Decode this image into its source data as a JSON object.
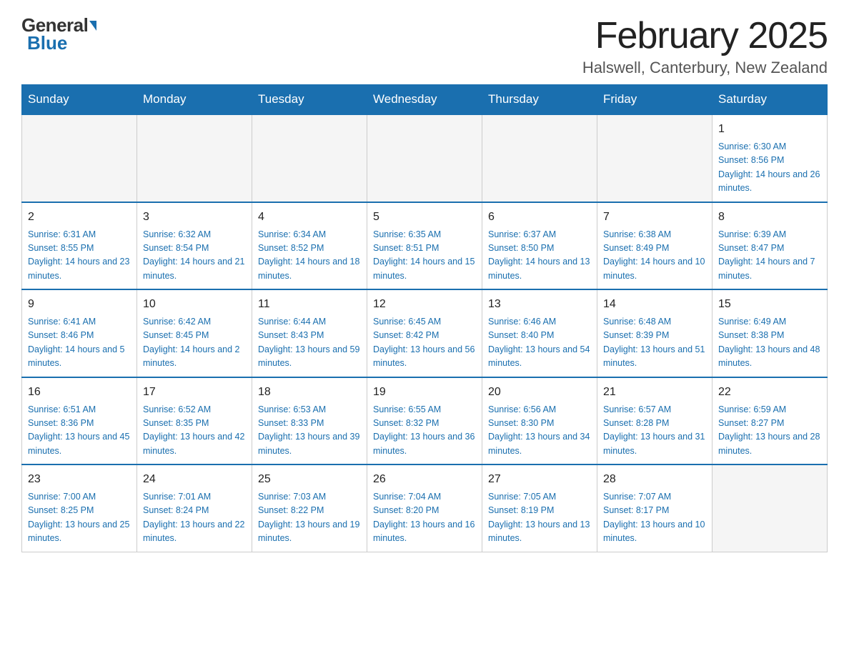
{
  "logo": {
    "general": "General",
    "blue": "Blue"
  },
  "title": "February 2025",
  "subtitle": "Halswell, Canterbury, New Zealand",
  "days_of_week": [
    "Sunday",
    "Monday",
    "Tuesday",
    "Wednesday",
    "Thursday",
    "Friday",
    "Saturday"
  ],
  "weeks": [
    [
      {
        "day": "",
        "empty": true
      },
      {
        "day": "",
        "empty": true
      },
      {
        "day": "",
        "empty": true
      },
      {
        "day": "",
        "empty": true
      },
      {
        "day": "",
        "empty": true
      },
      {
        "day": "",
        "empty": true
      },
      {
        "day": "1",
        "sunrise": "Sunrise: 6:30 AM",
        "sunset": "Sunset: 8:56 PM",
        "daylight": "Daylight: 14 hours and 26 minutes."
      }
    ],
    [
      {
        "day": "2",
        "sunrise": "Sunrise: 6:31 AM",
        "sunset": "Sunset: 8:55 PM",
        "daylight": "Daylight: 14 hours and 23 minutes."
      },
      {
        "day": "3",
        "sunrise": "Sunrise: 6:32 AM",
        "sunset": "Sunset: 8:54 PM",
        "daylight": "Daylight: 14 hours and 21 minutes."
      },
      {
        "day": "4",
        "sunrise": "Sunrise: 6:34 AM",
        "sunset": "Sunset: 8:52 PM",
        "daylight": "Daylight: 14 hours and 18 minutes."
      },
      {
        "day": "5",
        "sunrise": "Sunrise: 6:35 AM",
        "sunset": "Sunset: 8:51 PM",
        "daylight": "Daylight: 14 hours and 15 minutes."
      },
      {
        "day": "6",
        "sunrise": "Sunrise: 6:37 AM",
        "sunset": "Sunset: 8:50 PM",
        "daylight": "Daylight: 14 hours and 13 minutes."
      },
      {
        "day": "7",
        "sunrise": "Sunrise: 6:38 AM",
        "sunset": "Sunset: 8:49 PM",
        "daylight": "Daylight: 14 hours and 10 minutes."
      },
      {
        "day": "8",
        "sunrise": "Sunrise: 6:39 AM",
        "sunset": "Sunset: 8:47 PM",
        "daylight": "Daylight: 14 hours and 7 minutes."
      }
    ],
    [
      {
        "day": "9",
        "sunrise": "Sunrise: 6:41 AM",
        "sunset": "Sunset: 8:46 PM",
        "daylight": "Daylight: 14 hours and 5 minutes."
      },
      {
        "day": "10",
        "sunrise": "Sunrise: 6:42 AM",
        "sunset": "Sunset: 8:45 PM",
        "daylight": "Daylight: 14 hours and 2 minutes."
      },
      {
        "day": "11",
        "sunrise": "Sunrise: 6:44 AM",
        "sunset": "Sunset: 8:43 PM",
        "daylight": "Daylight: 13 hours and 59 minutes."
      },
      {
        "day": "12",
        "sunrise": "Sunrise: 6:45 AM",
        "sunset": "Sunset: 8:42 PM",
        "daylight": "Daylight: 13 hours and 56 minutes."
      },
      {
        "day": "13",
        "sunrise": "Sunrise: 6:46 AM",
        "sunset": "Sunset: 8:40 PM",
        "daylight": "Daylight: 13 hours and 54 minutes."
      },
      {
        "day": "14",
        "sunrise": "Sunrise: 6:48 AM",
        "sunset": "Sunset: 8:39 PM",
        "daylight": "Daylight: 13 hours and 51 minutes."
      },
      {
        "day": "15",
        "sunrise": "Sunrise: 6:49 AM",
        "sunset": "Sunset: 8:38 PM",
        "daylight": "Daylight: 13 hours and 48 minutes."
      }
    ],
    [
      {
        "day": "16",
        "sunrise": "Sunrise: 6:51 AM",
        "sunset": "Sunset: 8:36 PM",
        "daylight": "Daylight: 13 hours and 45 minutes."
      },
      {
        "day": "17",
        "sunrise": "Sunrise: 6:52 AM",
        "sunset": "Sunset: 8:35 PM",
        "daylight": "Daylight: 13 hours and 42 minutes."
      },
      {
        "day": "18",
        "sunrise": "Sunrise: 6:53 AM",
        "sunset": "Sunset: 8:33 PM",
        "daylight": "Daylight: 13 hours and 39 minutes."
      },
      {
        "day": "19",
        "sunrise": "Sunrise: 6:55 AM",
        "sunset": "Sunset: 8:32 PM",
        "daylight": "Daylight: 13 hours and 36 minutes."
      },
      {
        "day": "20",
        "sunrise": "Sunrise: 6:56 AM",
        "sunset": "Sunset: 8:30 PM",
        "daylight": "Daylight: 13 hours and 34 minutes."
      },
      {
        "day": "21",
        "sunrise": "Sunrise: 6:57 AM",
        "sunset": "Sunset: 8:28 PM",
        "daylight": "Daylight: 13 hours and 31 minutes."
      },
      {
        "day": "22",
        "sunrise": "Sunrise: 6:59 AM",
        "sunset": "Sunset: 8:27 PM",
        "daylight": "Daylight: 13 hours and 28 minutes."
      }
    ],
    [
      {
        "day": "23",
        "sunrise": "Sunrise: 7:00 AM",
        "sunset": "Sunset: 8:25 PM",
        "daylight": "Daylight: 13 hours and 25 minutes."
      },
      {
        "day": "24",
        "sunrise": "Sunrise: 7:01 AM",
        "sunset": "Sunset: 8:24 PM",
        "daylight": "Daylight: 13 hours and 22 minutes."
      },
      {
        "day": "25",
        "sunrise": "Sunrise: 7:03 AM",
        "sunset": "Sunset: 8:22 PM",
        "daylight": "Daylight: 13 hours and 19 minutes."
      },
      {
        "day": "26",
        "sunrise": "Sunrise: 7:04 AM",
        "sunset": "Sunset: 8:20 PM",
        "daylight": "Daylight: 13 hours and 16 minutes."
      },
      {
        "day": "27",
        "sunrise": "Sunrise: 7:05 AM",
        "sunset": "Sunset: 8:19 PM",
        "daylight": "Daylight: 13 hours and 13 minutes."
      },
      {
        "day": "28",
        "sunrise": "Sunrise: 7:07 AM",
        "sunset": "Sunset: 8:17 PM",
        "daylight": "Daylight: 13 hours and 10 minutes."
      },
      {
        "day": "",
        "empty": true
      }
    ]
  ]
}
